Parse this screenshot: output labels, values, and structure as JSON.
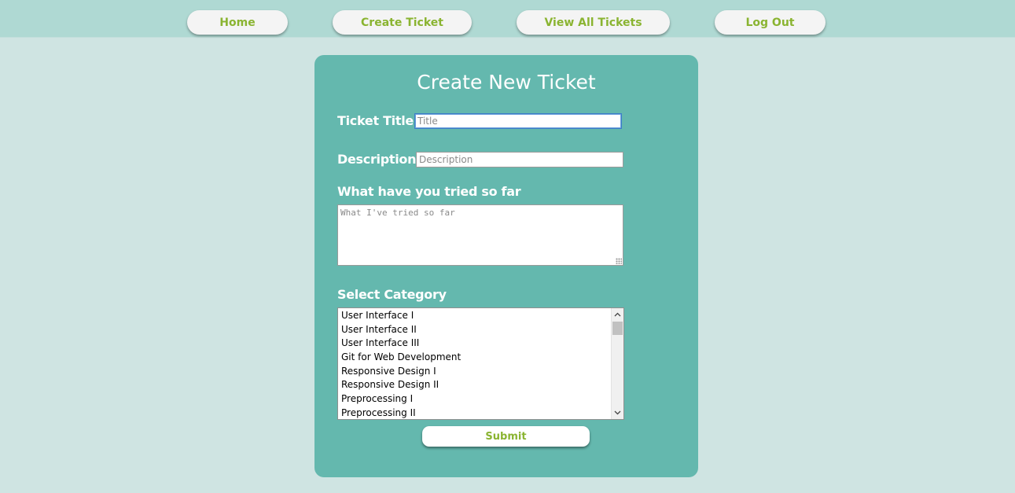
{
  "nav": {
    "items": [
      {
        "label": "Home"
      },
      {
        "label": "Create Ticket"
      },
      {
        "label": "View All Tickets"
      },
      {
        "label": "Log Out"
      }
    ]
  },
  "form": {
    "heading": "Create New Ticket",
    "title_label": "Ticket Title",
    "title_placeholder": "Title",
    "title_value": "",
    "description_label": "Description",
    "description_placeholder": "Description",
    "description_value": "",
    "tried_label": "What have you tried so far",
    "tried_placeholder": "What I've tried so far",
    "category_label": "Select Category",
    "categories": [
      "User Interface I",
      "User Interface II",
      "User Interface III",
      "Git for Web Development",
      "Responsive Design I",
      "Responsive Design II",
      "Preprocessing I",
      "Preprocessing II"
    ],
    "submit_label": "Submit"
  },
  "colors": {
    "page_bg": "#cfe4e2",
    "topbar_bg": "#afd9d3",
    "panel_bg": "#64b8ae",
    "accent_text": "#8ab431"
  },
  "icons": {
    "scroll_up": "chevron-up-icon",
    "scroll_down": "chevron-down-icon",
    "resize_grip": "resize-grip-icon"
  }
}
